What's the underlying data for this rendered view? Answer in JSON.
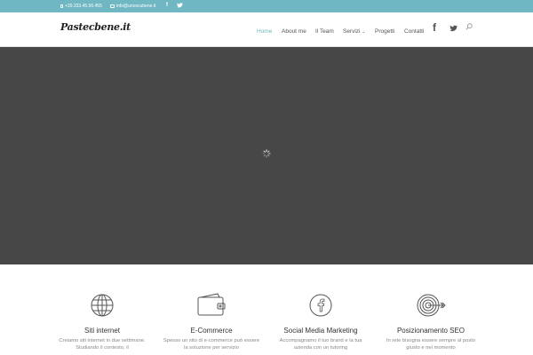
{
  "topbar": {
    "phone": "+39.333.45.96.455",
    "email": "info@unoscubene.it",
    "social": [
      "facebook-icon",
      "twitter-icon"
    ]
  },
  "header": {
    "logo": "Pastecbene.it",
    "nav": [
      "Home",
      "About me",
      "Il Team",
      "Servizi",
      "Progetti",
      "Contatti"
    ],
    "active": "Home",
    "servizi_caret": "⌄"
  },
  "services": [
    {
      "icon": "globe-icon",
      "title": "Siti internet",
      "desc": "Creiamo siti internet in due settimane. Studiando il contesto, il"
    },
    {
      "icon": "wallet-icon",
      "title": "E-Commerce",
      "desc": "Spesso un sito di e-commerce può essere la soluzione per servizio"
    },
    {
      "icon": "facebook-circle-icon",
      "title": "Social Media Marketing",
      "desc": "Accompagnamo il tuo brand e la tua azienda con un tutoring"
    },
    {
      "icon": "target-icon",
      "title": "Posizionamento SEO",
      "desc": "In rete bisogna essere sempre al posto giusto e nel momento"
    }
  ],
  "colors": {
    "accent": "#6fb7c2",
    "hero": "#474747"
  }
}
